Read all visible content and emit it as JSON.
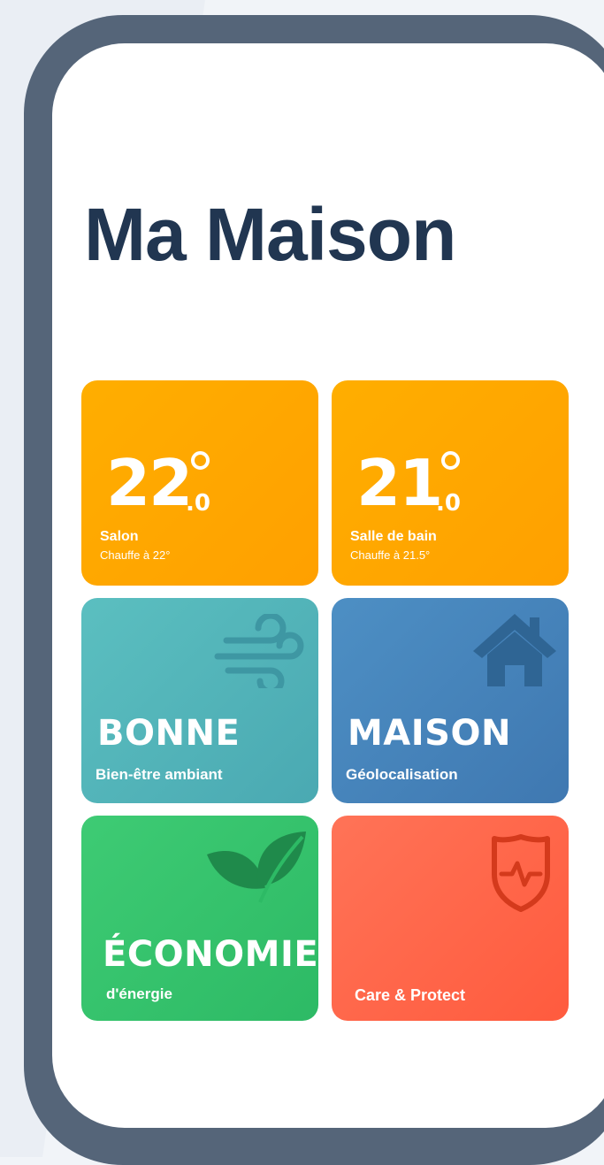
{
  "page": {
    "title": "Ma Maison"
  },
  "tiles": {
    "salon": {
      "temp_int": "22",
      "temp_dec": ".0",
      "name": "Salon",
      "status": "Chauffe à 22°"
    },
    "bath": {
      "temp_int": "21",
      "temp_dec": ".0",
      "name": "Salle de bain",
      "status": "Chauffe à 21.5°"
    },
    "air": {
      "title": "BONNE",
      "subtitle": "Bien-être ambiant",
      "icon": "wind-icon"
    },
    "home": {
      "title": "MAISON",
      "subtitle": "Géolocalisation",
      "icon": "house-icon"
    },
    "eco": {
      "title": "ÉCONOMIES",
      "subtitle": "d'énergie",
      "icon": "leaf-icon"
    },
    "care": {
      "title": "Care & Protect",
      "icon": "shield-heartbeat-icon"
    }
  },
  "colors": {
    "phone_frame": "#556579",
    "title": "#213651",
    "heating": "#ffa600",
    "air": "#52b4b9",
    "home": "#4684bb",
    "eco": "#34c36d",
    "care": "#ff6549"
  }
}
